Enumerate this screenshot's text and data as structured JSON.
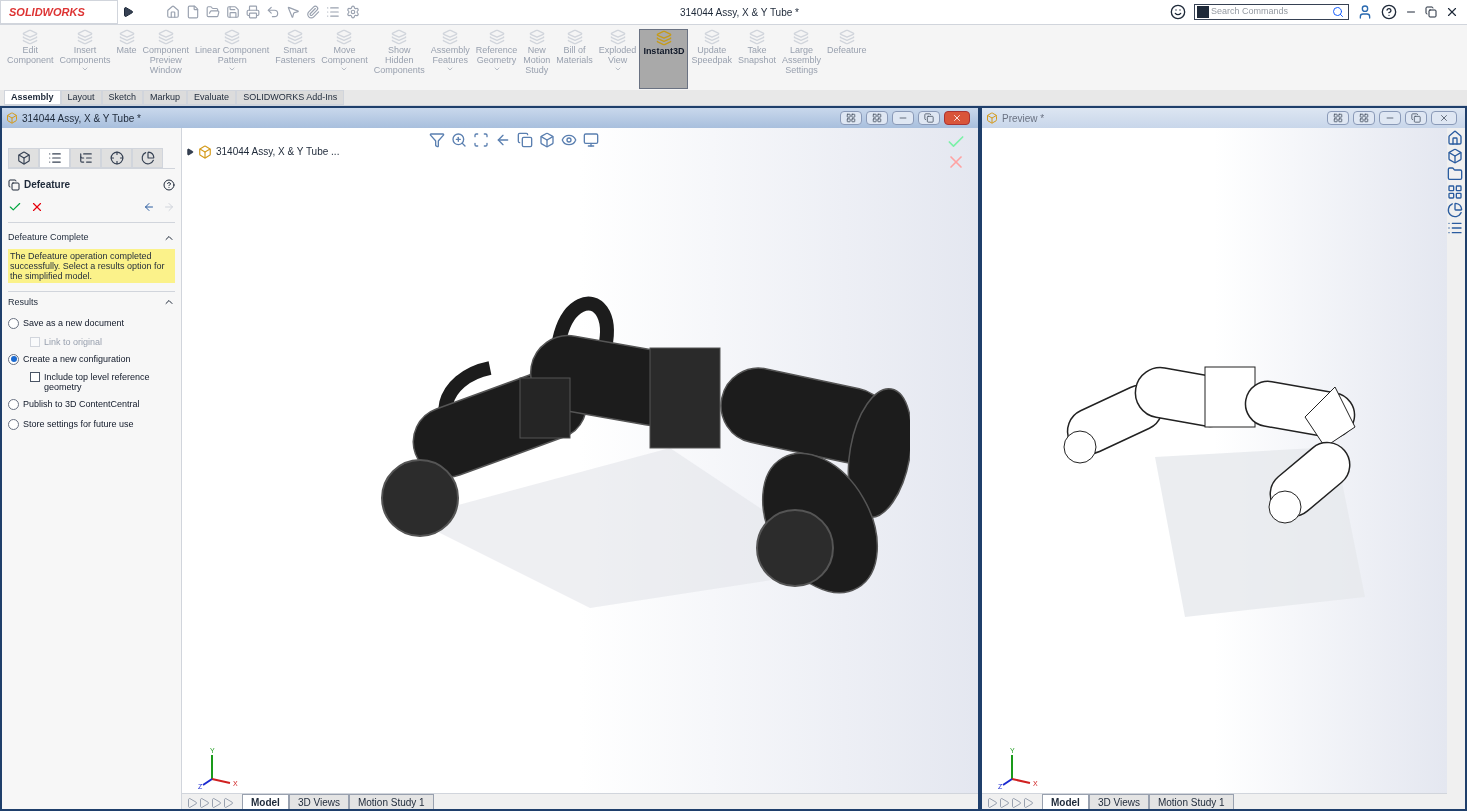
{
  "app": {
    "logo": "SOLIDWORKS",
    "title": "314044 Assy, X & Y Tube *",
    "search": {
      "placeholder": "Search Commands"
    }
  },
  "ribbon": [
    {
      "label": "Edit\nComponent",
      "dropdown": false,
      "selected": false
    },
    {
      "label": "Insert\nComponents",
      "dropdown": true,
      "selected": false
    },
    {
      "label": "Mate",
      "dropdown": false,
      "selected": false
    },
    {
      "label": "Component\nPreview\nWindow",
      "dropdown": false,
      "selected": false
    },
    {
      "label": "Linear Component\nPattern",
      "dropdown": true,
      "selected": false
    },
    {
      "label": "Smart\nFasteners",
      "dropdown": false,
      "selected": false
    },
    {
      "label": "Move\nComponent",
      "dropdown": true,
      "selected": false
    },
    {
      "label": "Show\nHidden\nComponents",
      "dropdown": false,
      "selected": false
    },
    {
      "label": "Assembly\nFeatures",
      "dropdown": true,
      "selected": false
    },
    {
      "label": "Reference\nGeometry",
      "dropdown": true,
      "selected": false
    },
    {
      "label": "New\nMotion\nStudy",
      "dropdown": false,
      "selected": false
    },
    {
      "label": "Bill of\nMaterials",
      "dropdown": false,
      "selected": false
    },
    {
      "label": "Exploded\nView",
      "dropdown": true,
      "selected": false
    },
    {
      "label": "Instant3D",
      "dropdown": false,
      "selected": true
    },
    {
      "label": "Update\nSpeedpak",
      "dropdown": false,
      "selected": false
    },
    {
      "label": "Take\nSnapshot",
      "dropdown": false,
      "selected": false
    },
    {
      "label": "Large\nAssembly\nSettings",
      "dropdown": false,
      "selected": false
    },
    {
      "label": "Defeature",
      "dropdown": false,
      "selected": false
    }
  ],
  "command_tabs": [
    {
      "label": "Assembly",
      "selected": true
    },
    {
      "label": "Layout",
      "selected": false
    },
    {
      "label": "Sketch",
      "selected": false
    },
    {
      "label": "Markup",
      "selected": false
    },
    {
      "label": "Evaluate",
      "selected": false
    },
    {
      "label": "SOLIDWORKS Add-Ins",
      "selected": false
    }
  ],
  "main_window": {
    "title": "314044 Assy, X & Y Tube *",
    "property_manager": {
      "tabs": [
        {
          "selected": false
        },
        {
          "selected": true
        },
        {
          "selected": false
        },
        {
          "selected": false
        },
        {
          "selected": false
        }
      ],
      "title": "Defeature",
      "message_section": {
        "title": "Defeature Complete",
        "message": "The Defeature operation completed successfully. Select a results option for the simplified model."
      },
      "results_section": {
        "title": "Results",
        "options": [
          {
            "kind": "radio",
            "label": "Save as a new document",
            "selected": false,
            "disabled": false,
            "children": [
              {
                "kind": "checkbox",
                "label": "Link to original",
                "checked": false,
                "disabled": true
              }
            ]
          },
          {
            "kind": "radio",
            "label": "Create a new configuration",
            "selected": true,
            "disabled": false,
            "children": [
              {
                "kind": "checkbox",
                "label": "Include top level reference geometry",
                "checked": false,
                "disabled": false
              }
            ]
          },
          {
            "kind": "radio",
            "label": "Publish to 3D ContentCentral",
            "selected": false,
            "disabled": false
          },
          {
            "kind": "radio",
            "label": "Store settings for future use",
            "selected": false,
            "disabled": false
          }
        ]
      }
    },
    "tree_root": "314044 Assy, X & Y Tube ...",
    "triad": {
      "x": "X",
      "y": "Y",
      "z": "Z"
    },
    "bottom_tabs": [
      {
        "label": "Model",
        "selected": true
      },
      {
        "label": "3D Views",
        "selected": false
      },
      {
        "label": "Motion Study 1",
        "selected": false
      }
    ]
  },
  "preview_window": {
    "title": "Preview *",
    "triad": {
      "x": "X",
      "y": "Y",
      "z": "Z"
    },
    "bottom_tabs": [
      {
        "label": "Model",
        "selected": true
      },
      {
        "label": "3D Views",
        "selected": false
      },
      {
        "label": "Motion Study 1",
        "selected": false
      }
    ]
  }
}
